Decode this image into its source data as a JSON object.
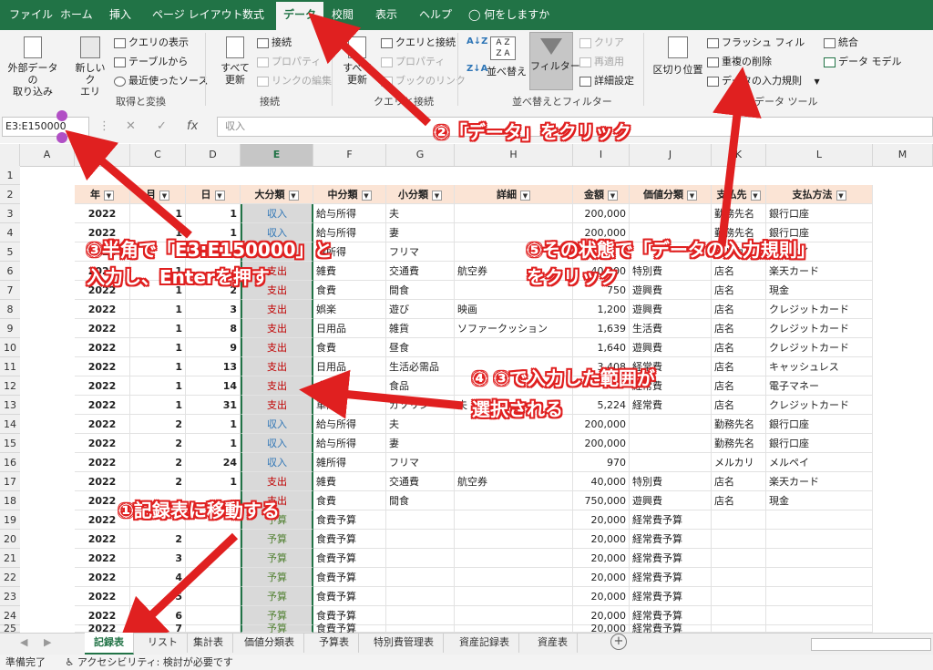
{
  "menu": {
    "items": [
      "ファイル",
      "ホーム",
      "挿入",
      "ページ レイアウト",
      "数式",
      "データ",
      "校閲",
      "表示",
      "ヘルプ"
    ],
    "tell_me": "何をしますか"
  },
  "ribbon": {
    "external": "外部データの\n取り込み",
    "new_query": "新しいク\nエリ",
    "show_queries": "クエリの表示",
    "from_table": "テーブルから",
    "recent_sources": "最近使ったソース",
    "group_get": "取得と変換",
    "refresh_all": "すべて\n更新",
    "connections": "接続",
    "properties": "プロパティ",
    "edit_links": "リンクの編集",
    "group_connections": "接続",
    "refresh_all2": "すべて\n更新",
    "queries_connections": "クエリと接続",
    "properties2": "プロパティ",
    "workbook_links": "ブックのリンク",
    "group_queries": "クエリと接続",
    "sort": "並べ替え",
    "filter": "フィルター",
    "clear": "クリア",
    "reapply": "再適用",
    "advanced": "詳細設定",
    "group_sort": "並べ替えとフィルター",
    "text_to_columns": "区切り位置",
    "flash_fill": "フラッシュ フィル",
    "remove_duplicates": "重複の削除",
    "data_validation": "データの入力規則",
    "consolidate": "統合",
    "data_model": "データ モデル",
    "group_tools": "データ ツール"
  },
  "formula_bar": {
    "name_box": "E3:E150000",
    "formula": "収入"
  },
  "columns": [
    "A",
    "B",
    "C",
    "D",
    "E",
    "F",
    "G",
    "H",
    "I",
    "J",
    "K",
    "L",
    "M"
  ],
  "header_row": [
    "年",
    "月",
    "日",
    "大分類",
    "中分類",
    "小分類",
    "詳細",
    "金額",
    "価値分類",
    "支払先",
    "支払方法"
  ],
  "rows": [
    {
      "n": "1",
      "c": []
    },
    {
      "n": "3",
      "c": [
        "2022",
        "1",
        "1",
        "収入",
        "給与所得",
        "夫",
        "",
        "200,000",
        "",
        "勤務先名",
        "銀行口座"
      ],
      "t": "inc"
    },
    {
      "n": "4",
      "c": [
        "2022",
        "1",
        "1",
        "収入",
        "給与所得",
        "妻",
        "",
        "200,000",
        "",
        "勤務先名",
        "銀行口座"
      ],
      "t": "inc"
    },
    {
      "n": "5",
      "c": [
        "2022",
        "1",
        "",
        "収入",
        "雑所得",
        "フリマ",
        "",
        "",
        "",
        "メルカリ",
        "メルペイ"
      ],
      "t": "inc"
    },
    {
      "n": "6",
      "c": [
        "2022",
        "1",
        "",
        "支出",
        "雑費",
        "交通費",
        "航空券",
        "40,000",
        "特別費",
        "店名",
        "楽天カード"
      ],
      "t": "exp"
    },
    {
      "n": "7",
      "c": [
        "2022",
        "1",
        "2",
        "支出",
        "食費",
        "間食",
        "",
        "750",
        "遊興費",
        "店名",
        "現金"
      ],
      "t": "exp"
    },
    {
      "n": "8",
      "c": [
        "2022",
        "1",
        "3",
        "支出",
        "娯楽",
        "遊び",
        "映画",
        "1,200",
        "遊興費",
        "店名",
        "クレジットカード"
      ],
      "t": "exp"
    },
    {
      "n": "9",
      "c": [
        "2022",
        "1",
        "8",
        "支出",
        "日用品",
        "雑貨",
        "ソファークッション",
        "1,639",
        "生活費",
        "店名",
        "クレジットカード"
      ],
      "t": "exp"
    },
    {
      "n": "10",
      "c": [
        "2022",
        "1",
        "9",
        "支出",
        "食費",
        "昼食",
        "",
        "1,640",
        "遊興費",
        "店名",
        "クレジットカード"
      ],
      "t": "exp"
    },
    {
      "n": "11",
      "c": [
        "2022",
        "1",
        "13",
        "支出",
        "日用品",
        "生活必需品",
        "",
        "3,408",
        "経常費",
        "店名",
        "キャッシュレス"
      ],
      "t": "exp"
    },
    {
      "n": "12",
      "c": [
        "2022",
        "1",
        "14",
        "支出",
        "食費",
        "食品",
        "",
        "",
        "経常費",
        "店名",
        "電子マネー"
      ],
      "t": "exp"
    },
    {
      "n": "13",
      "c": [
        "2022",
        "1",
        "31",
        "支出",
        "車両費",
        "ガソリン",
        "夫",
        "5,224",
        "経常費",
        "店名",
        "クレジットカード"
      ],
      "t": "exp"
    },
    {
      "n": "14",
      "c": [
        "2022",
        "2",
        "1",
        "収入",
        "給与所得",
        "夫",
        "",
        "200,000",
        "",
        "勤務先名",
        "銀行口座"
      ],
      "t": "inc"
    },
    {
      "n": "15",
      "c": [
        "2022",
        "2",
        "1",
        "収入",
        "給与所得",
        "妻",
        "",
        "200,000",
        "",
        "勤務先名",
        "銀行口座"
      ],
      "t": "inc"
    },
    {
      "n": "16",
      "c": [
        "2022",
        "2",
        "24",
        "収入",
        "雑所得",
        "フリマ",
        "",
        "970",
        "",
        "メルカリ",
        "メルペイ"
      ],
      "t": "inc"
    },
    {
      "n": "17",
      "c": [
        "2022",
        "2",
        "1",
        "支出",
        "雑費",
        "交通費",
        "航空券",
        "40,000",
        "特別費",
        "店名",
        "楽天カード"
      ],
      "t": "exp"
    },
    {
      "n": "18",
      "c": [
        "2022",
        "",
        "",
        "支出",
        "食費",
        "間食",
        "",
        "750,000",
        "遊興費",
        "店名",
        "現金"
      ],
      "t": "exp"
    },
    {
      "n": "19",
      "c": [
        "2022",
        "",
        "",
        "予算",
        "食費予算",
        "",
        "",
        "20,000",
        "経常費予算",
        "",
        ""
      ],
      "t": "bud"
    },
    {
      "n": "20",
      "c": [
        "2022",
        "2",
        "",
        "予算",
        "食費予算",
        "",
        "",
        "20,000",
        "経常費予算",
        "",
        ""
      ],
      "t": "bud"
    },
    {
      "n": "21",
      "c": [
        "2022",
        "3",
        "",
        "予算",
        "食費予算",
        "",
        "",
        "20,000",
        "経常費予算",
        "",
        ""
      ],
      "t": "bud"
    },
    {
      "n": "22",
      "c": [
        "2022",
        "4",
        "",
        "予算",
        "食費予算",
        "",
        "",
        "20,000",
        "経常費予算",
        "",
        ""
      ],
      "t": "bud"
    },
    {
      "n": "23",
      "c": [
        "2022",
        "5",
        "",
        "予算",
        "食費予算",
        "",
        "",
        "20,000",
        "経常費予算",
        "",
        ""
      ],
      "t": "bud"
    },
    {
      "n": "24",
      "c": [
        "2022",
        "6",
        "",
        "予算",
        "食費予算",
        "",
        "",
        "20,000",
        "経常費予算",
        "",
        ""
      ],
      "t": "bud"
    },
    {
      "n": "25",
      "c": [
        "2022",
        "7",
        "",
        "予算",
        "食費予算",
        "",
        "",
        "20,000",
        "経常費予算",
        "",
        ""
      ],
      "t": "bud"
    }
  ],
  "annotations": {
    "a1": "①記録表に移動する",
    "a2": "②「データ」をクリック",
    "a3_1": "③半角で「E3:E150000」と",
    "a3_2": "入力し、Enterを押す",
    "a4_1": "④ ③で入力した範囲が",
    "a4_2": "選択される",
    "a5_1": "⑤その状態で「データの入力規則」",
    "a5_2": "をクリック"
  },
  "tabs": [
    "記録表",
    "リスト",
    "集計表",
    "価値分類表",
    "予算表",
    "特別費管理表",
    "資産記録表",
    "資産表"
  ],
  "status": {
    "ready": "準備完了",
    "accessibility": "アクセシビリティ: 検討が必要です"
  },
  "colors": {
    "excel_green": "#217346",
    "arrow_red": "#e02020",
    "income": "#2e75b6",
    "expense": "#c00000",
    "budget": "#548235",
    "header_fill": "#fbe4d5"
  }
}
